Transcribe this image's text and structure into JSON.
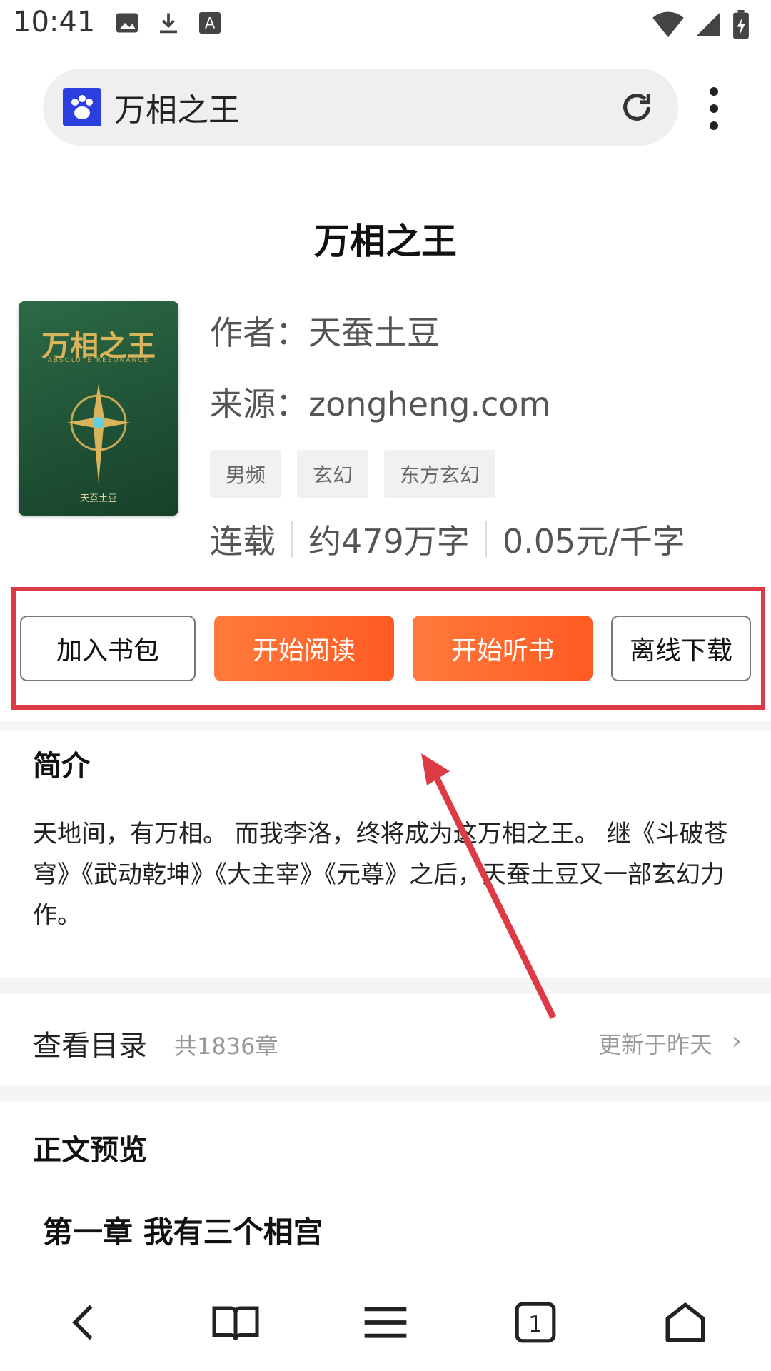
{
  "status_bar": {
    "time": "10:41"
  },
  "browser": {
    "url_text": "万相之王"
  },
  "book": {
    "title": "万相之王",
    "cover": {
      "title": "万相之王",
      "subtitle": "ABSOLUTE RESONANCE",
      "author": "天蚕土豆"
    },
    "author_line": "作者：天蚕土豆",
    "source_line": "来源：zongheng.com",
    "tags": [
      "男频",
      "玄幻",
      "东方玄幻"
    ],
    "status": "连载",
    "word_count": "约479万字",
    "price": "0.05元/千字"
  },
  "actions": {
    "add_to_shelf": "加入书包",
    "start_reading": "开始阅读",
    "start_listening": "开始听书",
    "offline_download": "离线下载"
  },
  "intro": {
    "heading": "简介",
    "text": "天地间，有万相。 而我李洛，终将成为这万相之王。 继《斗破苍穹》《武动乾坤》《大主宰》《元尊》之后，天蚕土豆又一部玄幻力作。"
  },
  "toc": {
    "label": "查看目录",
    "count": "共1836章",
    "updated": "更新于昨天"
  },
  "preview": {
    "heading": "正文预览",
    "chapter_title": "第一章 我有三个相宫"
  },
  "colors": {
    "accent_orange": "#ff5b23",
    "annotation_red": "#dc3a44"
  },
  "tab_count": "1"
}
